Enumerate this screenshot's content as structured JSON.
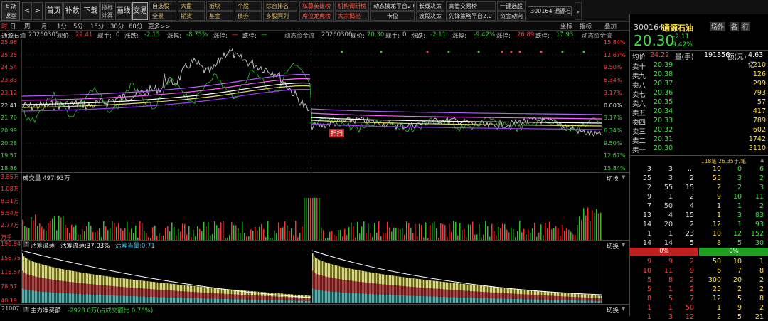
{
  "toolbar": {
    "logo": "互动\n课堂",
    "back": "<",
    "fwd": ">",
    "buttons": [
      "首页",
      "补数",
      "下载",
      "指标\n计算",
      "画线",
      "交易"
    ],
    "row1": [
      "自选股",
      "大盘",
      "板块",
      "个股",
      "综合排名"
    ],
    "row2": [
      "全景",
      "期货",
      "基金",
      "债券",
      "多股同列"
    ],
    "red1": [
      "私募英雄榜",
      "机构调研榜"
    ],
    "red2": [
      "席位龙虎榜",
      "大宗揭秘"
    ],
    "white1": [
      "动态擒龙平台2.0",
      "长线决策",
      "高管交易榜",
      "一键选股"
    ],
    "white2": [
      "卡位",
      "波段决策",
      "先锋策略平台2.0",
      "资金动向"
    ],
    "code_badge": "300164 通源石油"
  },
  "tabs": [
    "时",
    "日",
    "周",
    "月",
    "1分",
    "5分",
    "15分",
    "30分",
    "60分",
    "更多>>"
  ],
  "chart_tools": [
    "坐标",
    "指标",
    "叠加"
  ],
  "header_left": {
    "name": "通源石油",
    "date": "20260305",
    "price_lbl": "现价:",
    "price": "22.41",
    "vol_lbl": "现手:",
    "vol": "0",
    "chg_lbl": "涨跌:",
    "chg": "-2.15",
    "pct_lbl": "涨幅:",
    "pct": "-8.75%",
    "up_lbl": "涨停:",
    "up": "—",
    "dn_lbl": "跌停:",
    "dn": "—"
  },
  "header_mid": {
    "ind": "动态资金流",
    "date": "20260306",
    "price_lbl": "现价:",
    "price": "20.30",
    "vol_lbl": "现手:",
    "vol": "0",
    "chg_lbl": "涨跌:",
    "chg": "-2.11",
    "pct_lbl": "涨幅:",
    "pct": "-9.42%",
    "up_lbl": "涨停:",
    "up": "26.89",
    "dn_lbl": "跌停:",
    "dn": "17.93",
    "ind2": "动态资金流"
  },
  "price_axis": [
    "25.96",
    "25.25",
    "24.54",
    "23.83",
    "23.12",
    "22.41",
    "21.70",
    "20.99",
    "20.28",
    "19.57",
    "18.86"
  ],
  "pct_axis": [
    "15.84%",
    "12.67%",
    "9.50%",
    "6.34%",
    "3.17%",
    "0.00%",
    "3.17%",
    "6.34%",
    "9.50%",
    "12.67%",
    "15.84%"
  ],
  "kou_label": "扫扫",
  "vol_panel": {
    "title": "成交量 497.93万",
    "axis": [
      "3.85万",
      "1.08万",
      "8.31万",
      "5.54万",
      "2.77万",
      "万手"
    ],
    "switch": "切换"
  },
  "flow_panel": {
    "title": "活筹流速",
    "speed": "活筹流速:37.03%",
    "qty": "活筹当量:0.71",
    "axis": [
      "196.94",
      "156.75",
      "116.57",
      "78.57",
      "40.19"
    ],
    "switch": "切换"
  },
  "bottom_panel": {
    "left": "21007",
    "title": "主力净买额",
    "value": "-2928.0万(占成交额比 0.76%)",
    "switch": "切换"
  },
  "quote": {
    "code": "300164",
    "name": "通源石油",
    "tags": [
      "场外",
      "名",
      "行"
    ],
    "price": "20.30",
    "chg": "-2.11",
    "pct": "-9.42%",
    "avg_lbl": "均价",
    "avg": "24.22",
    "vol_lbl": "量(手)",
    "vol": "191356",
    "amt_lbl": "额(元)",
    "amt": "4.63亿",
    "asks": [
      {
        "l": "卖十",
        "p": "20.39",
        "v": "210"
      },
      {
        "l": "卖九",
        "p": "20.38",
        "v": "126"
      },
      {
        "l": "卖八",
        "p": "20.37",
        "v": "299"
      },
      {
        "l": "卖七",
        "p": "20.36",
        "v": "793"
      },
      {
        "l": "卖六",
        "p": "20.35",
        "v": "57"
      },
      {
        "l": "卖五",
        "p": "20.34",
        "v": "417"
      },
      {
        "l": "卖四",
        "p": "20.33",
        "v": "789"
      },
      {
        "l": "卖三",
        "p": "20.32",
        "v": "602"
      },
      {
        "l": "卖二",
        "p": "20.31",
        "v": "1742"
      },
      {
        "l": "卖一",
        "p": "20.30",
        "v": "3110"
      }
    ],
    "ticker": "118笔 26.35手/笔",
    "grid_top": [
      [
        "3",
        "3",
        "...",
        "10",
        "0",
        "6"
      ],
      [
        "55",
        "3",
        "2",
        "55",
        "3",
        "2"
      ],
      [
        "2",
        "55",
        "15",
        "2",
        "2",
        "3"
      ],
      [
        "9",
        "1",
        "2",
        "9",
        "10",
        "11"
      ],
      [
        "7",
        "50",
        "4",
        "1",
        "1",
        "2"
      ],
      [
        "13",
        "4",
        "15",
        "1",
        "3",
        "83"
      ],
      [
        "14",
        "20",
        "2",
        "12",
        "1",
        "93"
      ],
      [
        "1",
        "1",
        "23",
        "10",
        "12",
        "152"
      ],
      [
        "14",
        "14",
        "5",
        "8",
        "5",
        "30"
      ]
    ],
    "pct_bar": [
      "0%",
      "0%"
    ],
    "grid_bot": [
      [
        "9",
        "9",
        "2",
        "50",
        "10",
        "1"
      ],
      [
        "10",
        "11",
        "9",
        "6",
        "7",
        "8"
      ],
      [
        "5",
        "8",
        "2",
        "300",
        "20",
        "2"
      ],
      [
        "5",
        "1",
        "2",
        "25",
        "2",
        "2"
      ],
      [
        "8",
        "5",
        "7",
        "12",
        "5",
        "8"
      ],
      [
        "1",
        "1",
        "50",
        "1",
        "9",
        "2"
      ],
      [
        "1",
        "3",
        "12",
        "2",
        "5",
        "21"
      ]
    ]
  }
}
